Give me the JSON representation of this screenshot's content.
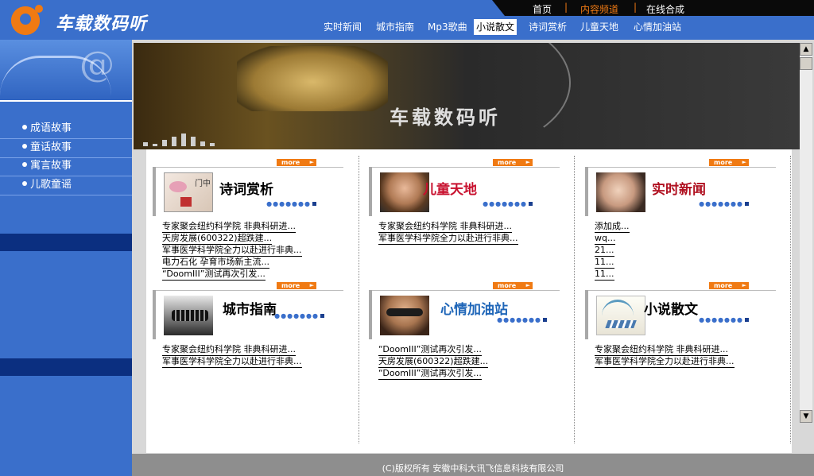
{
  "header": {
    "logo_text": "车载数码听",
    "top_links": [
      "首页",
      "内容频道",
      "在线合成"
    ],
    "top_separator": "|",
    "active_top_link_color": "#f07a13",
    "nav": [
      "实时新闻",
      "城市指南",
      "Mp3歌曲",
      "小说散文",
      "诗词赏析",
      "儿童天地",
      "心情加油站"
    ],
    "active_nav": "小说散文"
  },
  "sidebar": {
    "items": [
      "成语故事",
      "童话故事",
      "寓言故事",
      "儿歌童谣"
    ]
  },
  "hero": {
    "title": "车载数码听"
  },
  "more_label": "more",
  "panels": [
    {
      "title": "诗词赏析",
      "icon": "poem-icon",
      "items": [
        "专家聚会纽约科学院 非典科研进...",
        "天房发展(600322)超跌建...",
        "军事医学科学院全力以赴进行非典...",
        "电力石化 孕育市场新主流...",
        "“DoomIII”测试再次引发..."
      ]
    },
    {
      "title": "儿童天地",
      "icon": "child-icon",
      "items": [
        "专家聚会纽约科学院 非典科研进...",
        "军事医学科学院全力以赴进行非典..."
      ]
    },
    {
      "title": "实时新闻",
      "icon": "news-icon",
      "items": [
        "添加成...",
        "wq...",
        "21...",
        "11...",
        "11..."
      ]
    },
    {
      "title": "城市指南",
      "icon": "city-icon",
      "items": [
        "专家聚会纽约科学院 非典科研进...",
        "军事医学科学院全力以赴进行非典..."
      ]
    },
    {
      "title": "心情加油站",
      "icon": "mood-icon",
      "items": [
        "“DoomIII”测试再次引发...",
        "天房发展(600322)超跌建...",
        "“DoomIII”测试再次引发..."
      ]
    },
    {
      "title": "小说散文",
      "icon": "novel-icon",
      "items": [
        "专家聚会纽约科学院 非典科研进...",
        "军事医学科学院全力以赴进行非典..."
      ]
    }
  ],
  "scrollbar": {
    "up": "▲",
    "down": "▼"
  },
  "footer": {
    "copyright": "(C)版权所有 安徽中科大讯飞信息科技有限公司"
  },
  "colors": {
    "brand_blue": "#3a6fcb",
    "accent_orange": "#f07a13",
    "dark_band": "#0b2f80"
  }
}
